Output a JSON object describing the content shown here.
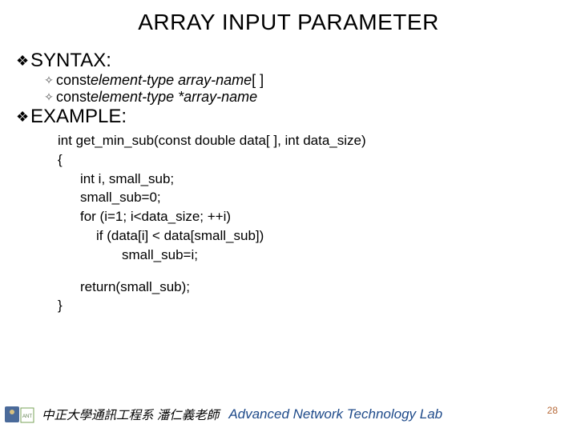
{
  "title": "ARRAY INPUT PARAMETER",
  "sections": {
    "syntax": {
      "heading": "SYNTAX:",
      "items": [
        {
          "prefix": "const ",
          "italic": "element-type array-name",
          "suffix": " [ ]"
        },
        {
          "prefix": "const ",
          "italic": "element-type *array-name",
          "suffix": ""
        }
      ]
    },
    "example": {
      "heading": "EXAMPLE:",
      "code": [
        {
          "indent": 1,
          "text": "int get_min_sub(const double data[ ], int data_size)"
        },
        {
          "indent": 1,
          "text": "{"
        },
        {
          "indent": 2,
          "text": "int i, small_sub;"
        },
        {
          "indent": 2,
          "text": "small_sub=0;"
        },
        {
          "indent": 2,
          "text": "for (i=1; i<data_size; ++i)"
        },
        {
          "indent": 3,
          "text": "if (data[i] < data[small_sub])"
        },
        {
          "indent": 4,
          "text": "small_sub=i;"
        },
        {
          "indent": 0,
          "text": ""
        },
        {
          "indent": 2,
          "text": "return(small_sub);"
        },
        {
          "indent": 1,
          "text": "}"
        }
      ]
    }
  },
  "footer": {
    "cn": "中正大學通訊工程系 潘仁義老師",
    "en": "Advanced Network Technology Lab"
  },
  "page": "28"
}
